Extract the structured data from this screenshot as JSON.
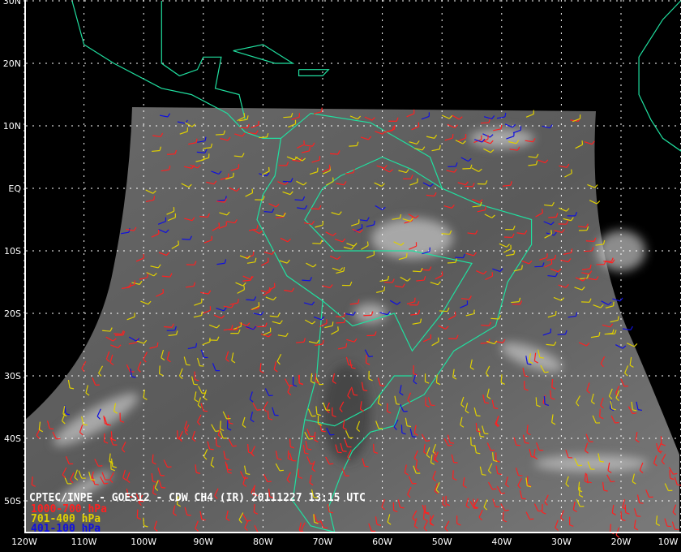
{
  "title": "CPTEC/INPE - GOES12 - CDW CH4 (IR) 20111227 13:15 UTC",
  "legend": [
    {
      "label": "1000-700 hPa",
      "color": "#ff2020"
    },
    {
      "label": "701-400 hPa",
      "color": "#e0d000"
    },
    {
      "label": "401-100 hPa",
      "color": "#1010e0"
    }
  ],
  "lat_labels": [
    "30N",
    "20N",
    "10N",
    "EQ",
    "10S",
    "20S",
    "30S",
    "40S",
    "50S"
  ],
  "lon_labels": [
    "120W",
    "110W",
    "100W",
    "90W",
    "80W",
    "70W",
    "60W",
    "50W",
    "40W",
    "30W",
    "20W",
    "10W"
  ],
  "colors": {
    "coastline": "#20e0a0",
    "grid": "#ffffff",
    "background": "#000000"
  }
}
